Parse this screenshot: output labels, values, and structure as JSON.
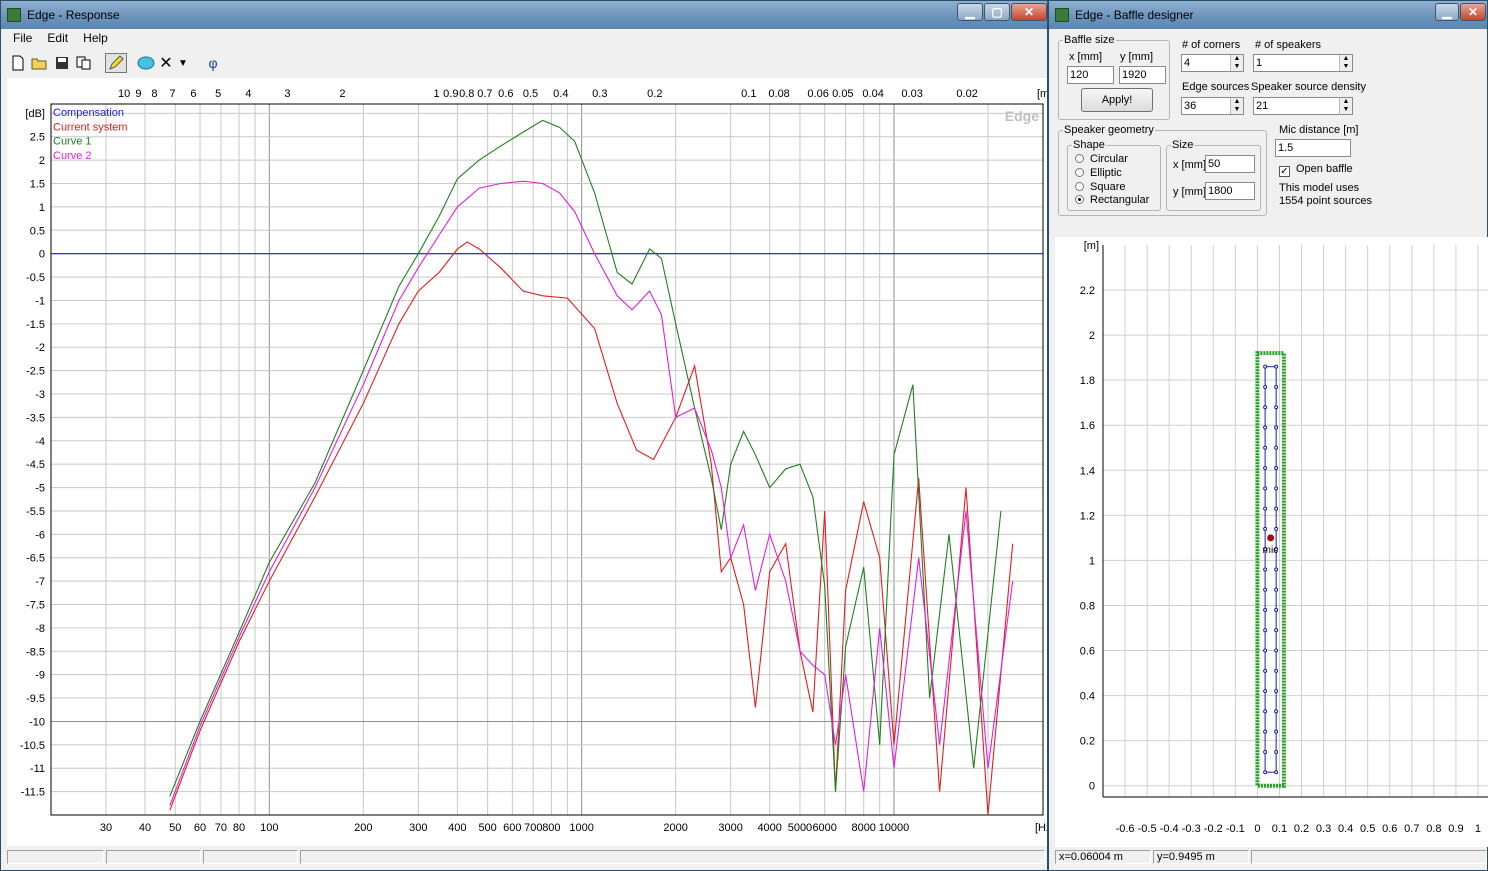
{
  "response": {
    "title": "Edge - Response",
    "menu": [
      "File",
      "Edit",
      "Help"
    ],
    "toolbar": [
      {
        "name": "new-file-icon",
        "glyph": "🗋"
      },
      {
        "name": "open-folder-icon",
        "glyph": "📂"
      },
      {
        "name": "save-icon",
        "glyph": "💾"
      },
      {
        "name": "copy-icon",
        "glyph": "⎘"
      },
      {
        "name": "pencil-icon",
        "glyph": "✎"
      },
      {
        "name": "speaker-icon",
        "glyph": "◆"
      },
      {
        "name": "delete-icon",
        "glyph": "✕"
      },
      {
        "name": "dropdown-arrow-icon",
        "glyph": "▾"
      },
      {
        "name": "phase-icon",
        "glyph": "φ"
      }
    ],
    "watermark": "Edge",
    "status": [
      "",
      "",
      "",
      ""
    ]
  },
  "chart_data": {
    "type": "line",
    "ylabel": "[dB]",
    "xlabel": "[Hz]",
    "top_axis_label": "[m]",
    "x_scale": "log",
    "xlim": [
      20,
      30000
    ],
    "ylim": [
      -12,
      3.2
    ],
    "grid": true,
    "legend_placement": "top-left",
    "y_ticks": [
      2.5,
      2,
      1.5,
      1,
      0.5,
      0,
      -0.5,
      -1,
      -1.5,
      -2,
      -2.5,
      -3,
      -3.5,
      -4,
      -4.5,
      -5,
      -5.5,
      -6,
      -6.5,
      -7,
      -7.5,
      -8,
      -8.5,
      -9,
      -9.5,
      -10,
      -10.5,
      -11,
      -11.5
    ],
    "x_tick_labels": [
      30,
      40,
      50,
      60,
      70,
      80,
      100,
      200,
      300,
      400,
      500,
      600,
      700,
      800,
      1000,
      2000,
      3000,
      4000,
      5000,
      6000,
      8000,
      10000
    ],
    "top_tick_labels": [
      10,
      9,
      8,
      7,
      6,
      5,
      4,
      3,
      2,
      1,
      0.9,
      0.8,
      0.7,
      0.6,
      0.5,
      0.4,
      0.3,
      0.2,
      0.1,
      0.08,
      0.06,
      0.05,
      0.04,
      0.03,
      0.02
    ],
    "series": [
      {
        "name": "Compensation",
        "color": "#2020e0",
        "x": [
          20,
          30000
        ],
        "y": [
          0,
          0
        ]
      },
      {
        "name": "Current system",
        "color": "#e02020",
        "x": [
          48,
          60,
          80,
          100,
          140,
          200,
          260,
          300,
          350,
          400,
          430,
          470,
          550,
          650,
          750,
          900,
          1100,
          1300,
          1500,
          1700,
          2000,
          2300,
          2600,
          2800,
          3000,
          3300,
          3600,
          4000,
          4500,
          5000,
          5500,
          6000,
          6500,
          7000,
          8000,
          9000,
          10000,
          12000,
          14000,
          17000,
          20000,
          24000
        ],
        "y": [
          -11.9,
          -10.2,
          -8.3,
          -7.0,
          -5.2,
          -3.2,
          -1.5,
          -0.8,
          -0.4,
          0.1,
          0.25,
          0.1,
          -0.3,
          -0.8,
          -0.9,
          -0.95,
          -1.6,
          -3.2,
          -4.2,
          -4.4,
          -3.5,
          -2.4,
          -4.5,
          -6.8,
          -6.5,
          -7.5,
          -9.7,
          -6.8,
          -6.2,
          -8.5,
          -9.8,
          -5.5,
          -11.5,
          -7.2,
          -5.3,
          -6.5,
          -10.5,
          -4.8,
          -11.5,
          -5.0,
          -12,
          -6.2
        ]
      },
      {
        "name": "Curve 1",
        "color": "#208020",
        "x": [
          48,
          60,
          80,
          100,
          140,
          200,
          260,
          300,
          350,
          400,
          470,
          550,
          650,
          750,
          850,
          950,
          1100,
          1300,
          1450,
          1650,
          1800,
          2000,
          2300,
          2600,
          2800,
          3000,
          3300,
          3600,
          4000,
          4500,
          5000,
          5500,
          6000,
          6500,
          7000,
          8000,
          9000,
          10000,
          11500,
          13000,
          15000,
          18000,
          22000
        ],
        "y": [
          -11.6,
          -10.0,
          -8.1,
          -6.6,
          -4.9,
          -2.5,
          -0.7,
          0.0,
          0.8,
          1.6,
          2.0,
          2.3,
          2.6,
          2.85,
          2.7,
          2.4,
          1.3,
          -0.4,
          -0.65,
          0.1,
          -0.1,
          -1.5,
          -3.3,
          -4.8,
          -5.9,
          -4.5,
          -3.8,
          -4.3,
          -5.0,
          -4.6,
          -4.5,
          -5.2,
          -7.1,
          -11.5,
          -8.4,
          -6.7,
          -10.5,
          -4.3,
          -2.8,
          -9.5,
          -6.0,
          -11.0,
          -5.5
        ]
      },
      {
        "name": "Curve 2",
        "color": "#e020e0",
        "x": [
          48,
          60,
          80,
          100,
          140,
          200,
          260,
          300,
          350,
          400,
          470,
          550,
          650,
          750,
          850,
          950,
          1100,
          1300,
          1450,
          1650,
          1800,
          2000,
          2300,
          2600,
          2800,
          3000,
          3300,
          3600,
          4000,
          4500,
          5000,
          5500,
          6000,
          6500,
          7000,
          8000,
          9000,
          10000,
          12000,
          14000,
          17000,
          20000,
          24000
        ],
        "y": [
          -11.8,
          -10.1,
          -8.2,
          -6.8,
          -5.0,
          -2.8,
          -1.0,
          -0.3,
          0.4,
          1.0,
          1.4,
          1.5,
          1.55,
          1.5,
          1.3,
          0.9,
          0.0,
          -0.9,
          -1.2,
          -0.8,
          -1.3,
          -3.5,
          -3.3,
          -4.2,
          -5.0,
          -6.5,
          -5.8,
          -7.2,
          -6.0,
          -7.0,
          -8.5,
          -8.8,
          -9.0,
          -10.5,
          -9.0,
          -11.5,
          -8.0,
          -11.0,
          -6.5,
          -10.5,
          -5.5,
          -11.0,
          -7.0
        ]
      }
    ]
  },
  "designer": {
    "title": "Edge - Baffle designer",
    "baffle_size_legend": "Baffle size",
    "x_label": "x [mm]",
    "y_label": "y [mm]",
    "x_value": "120",
    "y_value": "1920",
    "apply_label": "Apply!",
    "corners_label": "# of corners",
    "corners_value": "4",
    "speakers_label": "# of speakers",
    "speakers_value": "1",
    "edge_sources_label": "Edge sources",
    "edge_sources_value": "36",
    "density_label": "Speaker source density",
    "density_value": "21",
    "geometry_legend": "Speaker geometry",
    "shape_legend": "Shape",
    "shapes": [
      "Circular",
      "Elliptic",
      "Square",
      "Rectangular"
    ],
    "selected_shape": "Rectangular",
    "size_legend": "Size",
    "size_x_label": "x [mm]",
    "size_x_value": "50",
    "size_y_label": "y [mm]",
    "size_y_value": "1800",
    "mic_label": "Mic distance [m]",
    "mic_value": "1.5",
    "open_baffle_label": "Open baffle",
    "open_baffle_checked": true,
    "model_line1": "This model uses",
    "model_line2": "1554 point sources",
    "plot_unit": "[m]",
    "mic_marker": "mic",
    "y_ticks": [
      2.2,
      2,
      1.8,
      1.6,
      1.4,
      1.2,
      1,
      0.8,
      0.6,
      0.4,
      0.2,
      0
    ],
    "x_ticks": [
      -0.6,
      -0.5,
      -0.4,
      -0.3,
      -0.2,
      -0.1,
      0,
      0.1,
      0.2,
      0.3,
      0.4,
      0.5,
      0.6,
      0.7,
      0.8,
      0.9,
      1
    ],
    "baffle_width_m": 0.12,
    "baffle_height_m": 1.92,
    "speaker_width_m": 0.05,
    "speaker_height_m": 1.8,
    "mic_x_m": 0.06,
    "mic_y_m": 1.1,
    "status_x": "x=0.06004 m",
    "status_y": "y=0.9495 m"
  }
}
